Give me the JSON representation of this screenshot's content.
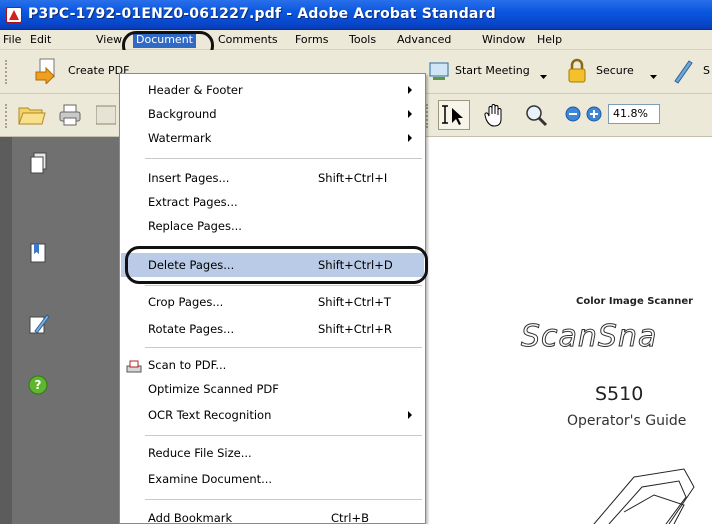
{
  "window": {
    "title": "P3PC-1792-01ENZ0-061227.pdf - Adobe Acrobat Standard"
  },
  "menubar": {
    "items": [
      "File",
      "Edit",
      "View",
      "Document",
      "Comments",
      "Forms",
      "Tools",
      "Advanced",
      "Window",
      "Help"
    ],
    "active": "Document"
  },
  "toolbar1": {
    "create_pdf": "Create PDF",
    "start_meeting": "Start Meeting",
    "secure": "Secure",
    "sign": "S"
  },
  "toolbar2": {
    "zoom": "41.8%"
  },
  "document_menu": {
    "header_footer": "Header & Footer",
    "background": "Background",
    "watermark": "Watermark",
    "insert_pages": "Insert Pages...",
    "insert_pages_shortcut": "Shift+Ctrl+I",
    "extract_pages": "Extract Pages...",
    "replace_pages": "Replace Pages...",
    "delete_pages": "Delete Pages...",
    "delete_pages_shortcut": "Shift+Ctrl+D",
    "crop_pages": "Crop Pages...",
    "crop_pages_shortcut": "Shift+Ctrl+T",
    "rotate_pages": "Rotate Pages...",
    "rotate_pages_shortcut": "Shift+Ctrl+R",
    "scan_to_pdf": "Scan to PDF...",
    "optimize_scanned": "Optimize Scanned PDF",
    "ocr": "OCR Text Recognition",
    "reduce_file_size": "Reduce File Size...",
    "examine_document": "Examine Document...",
    "add_bookmark": "Add Bookmark",
    "add_bookmark_shortcut": "Ctrl+B"
  },
  "document": {
    "subtitle": "Color Image Scanner",
    "logo": "ScanSna",
    "model": "S510",
    "guide": "Operator's Guide"
  },
  "colors": {
    "titlebar": "#0a57e0",
    "menu_highlight": "#b9cbe6",
    "active_menu": "#316ac5",
    "chrome": "#ece9d8"
  }
}
